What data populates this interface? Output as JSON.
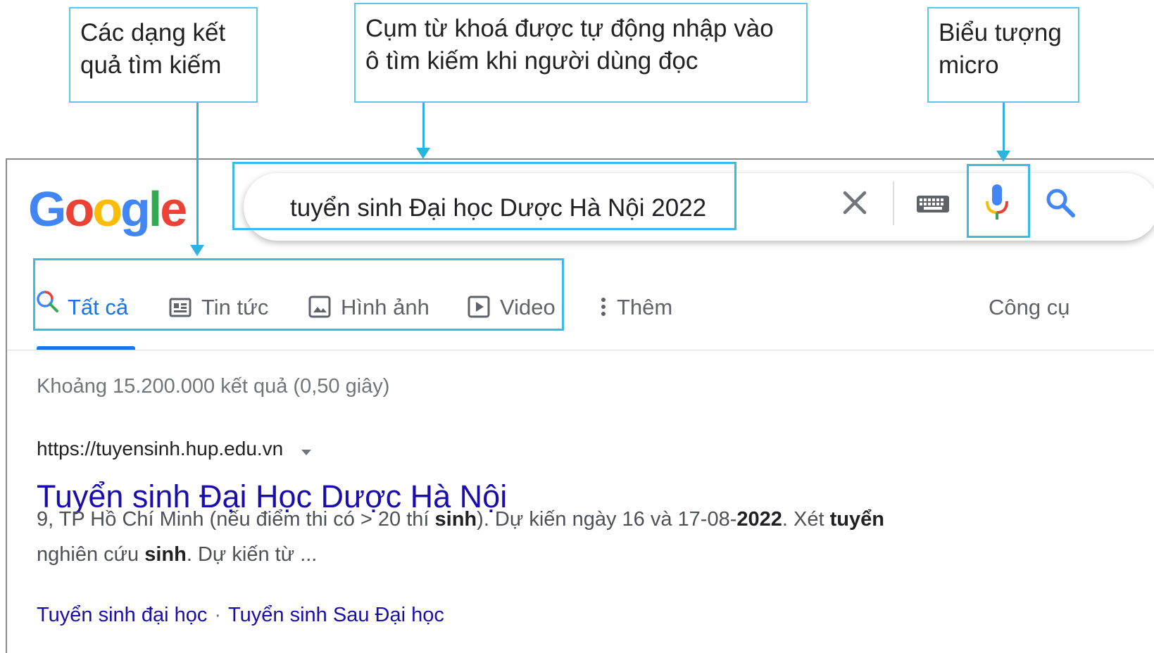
{
  "callouts": {
    "result_types": "Các dạng kết\nquả tìm kiếm",
    "auto_keyword": "Cụm từ khoá được tự động nhập vào\nô tìm kiếm khi người dùng đọc",
    "mic_icon": "Biểu tượng\nmicro"
  },
  "logo": {
    "letters": [
      "G",
      "o",
      "o",
      "g",
      "l",
      "e"
    ],
    "colors": [
      "#4285f4",
      "#ea4335",
      "#fbbc05",
      "#4285f4",
      "#34a853",
      "#ea4335"
    ]
  },
  "search": {
    "query": "tuyển sinh Đại học Dược Hà Nội 2022",
    "icons": [
      "close-icon",
      "keyboard-icon",
      "microphone-icon",
      "search-icon"
    ]
  },
  "tabs": {
    "all": "Tất cả",
    "news": "Tin tức",
    "images": "Hình ảnh",
    "videos": "Video",
    "more": "Thêm",
    "tools": "Công cụ"
  },
  "results": {
    "stats": "Khoảng 15.200.000 kết quả (0,50 giây)",
    "url": "https://tuyensinh.hup.edu.vn",
    "title": "Tuyển sinh Đại Học Dược Hà Nội",
    "snippet_line1": [
      {
        "t": "9, TP Hồ Chí Minh (nếu điểm thi có > 20 thí ",
        "b": false
      },
      {
        "t": "sinh",
        "b": true
      },
      {
        "t": "). Dự kiến ngày 16 và 17-08-",
        "b": false
      },
      {
        "t": "2022",
        "b": true
      },
      {
        "t": ". Xét ",
        "b": false
      },
      {
        "t": "tuyển",
        "b": true
      }
    ],
    "snippet_line2": [
      {
        "t": "nghiên cứu ",
        "b": false
      },
      {
        "t": "sinh",
        "b": true
      },
      {
        "t": ". Dự kiến từ ...",
        "b": false
      }
    ],
    "sitelink1": "Tuyển sinh đại học",
    "sitelink_sep": "·",
    "sitelink2": "Tuyển sinh Sau Đại học"
  },
  "colors": {
    "highlight": "#38bce6",
    "link": "#1a0dab",
    "active_tab": "#1a73e8"
  }
}
